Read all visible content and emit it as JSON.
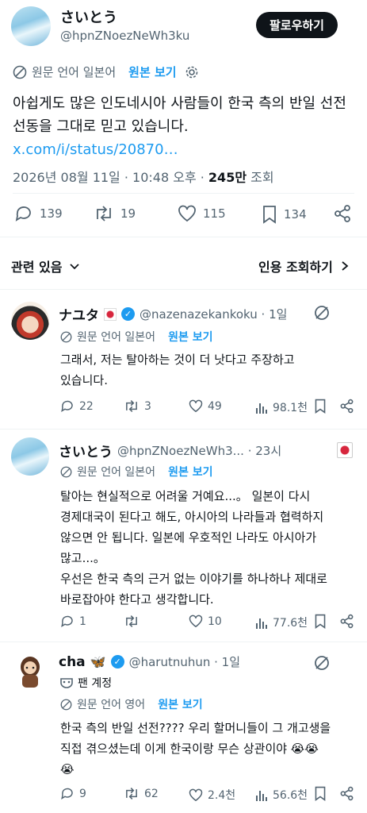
{
  "main_post": {
    "display_name": "さいとう",
    "handle": "@hpnZNoezNeWh3ku",
    "follow_label": "팔로우하기",
    "translate_label": "원문 언어 일본어",
    "show_original": "원본 보기",
    "text_line1": "아쉽게도 많은 인도네시아 사람들이 한국 측의 반일 선전",
    "text_line2": "선동을 그대로 믿고 있습니다.",
    "link": "x.com/i/status/20870…",
    "timestamp": "2026년 08월 11일 · 10:48 오후 · ",
    "views_count": "245만",
    "views_label": " 조회",
    "replies": "139",
    "reposts": "19",
    "likes": "115",
    "bookmarks": "134"
  },
  "related_bar": {
    "related_label": "관련 있음",
    "quotes_label": "인용 조회하기"
  },
  "replies": [
    {
      "display_name": "ナユタ",
      "handle": "@nazenazekankoku · 1일",
      "translate_label": "원문 언어 일본어",
      "show_original": "원본 보기",
      "text_line1": "그래서, 저는 탈아하는 것이 더 낫다고 주장하고",
      "text_line2": "있습니다.",
      "replies": "22",
      "reposts": "3",
      "likes": "49",
      "views": "98.1천"
    },
    {
      "display_name": "さいとう",
      "handle": "@hpnZNoezNeWh3... · 23시",
      "translate_label": "원문 언어 일본어",
      "show_original": "원본 보기",
      "text_line1": "탈아는 현실적으로 어려울 거예요...。 일본이 다시",
      "text_line2": "경제대국이 된다고 해도, 아시아의 나라들과 협력하지",
      "text_line3": "않으면 안 됩니다. 일본에 우호적인 나라도 아시아가",
      "text_line4": "많고...。",
      "text_line5": "우선은 한국 측의 근거 없는 이야기를 하나하나 제대로",
      "text_line6": "바로잡아야 한다고 생각합니다.",
      "replies": "1",
      "reposts": "",
      "likes": "10",
      "views": "77.6천"
    },
    {
      "display_name": "cha",
      "handle": "@harutnuhun · 1일",
      "fan_label": "팬 계정",
      "translate_label": "원문 언어 영어",
      "show_original": "원본 보기",
      "text_line1": "한국 측의 반일 선전???? 우리 할머니들이 그 개고생을",
      "text_line2": "직접 겪으셨는데 이게 한국이랑 무슨 상관이야 😭😭",
      "text_line3": "😭",
      "replies": "9",
      "reposts": "62",
      "likes": "2.4천",
      "views": "56.6천"
    }
  ],
  "icons": [
    "translate-icon",
    "gear-icon",
    "reply-icon",
    "repost-icon",
    "like-icon",
    "bookmark-icon",
    "share-icon",
    "chevron-down-icon",
    "chevron-right-icon",
    "grok-icon",
    "views-icon",
    "verified-badge-icon",
    "mask-icon"
  ],
  "colors": {
    "accent": "#1d9bf0",
    "text": "#0f1419",
    "secondary": "#536471",
    "divider": "#eff3f4"
  }
}
